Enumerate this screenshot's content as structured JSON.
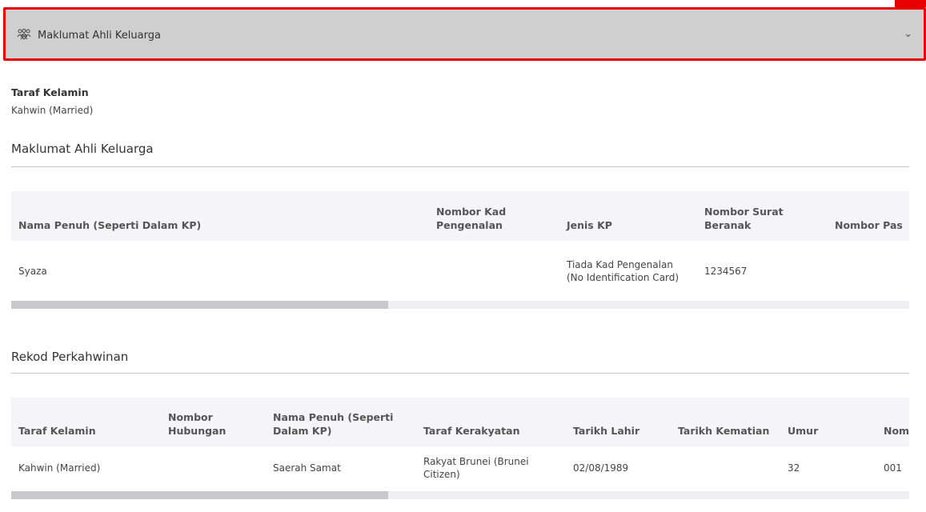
{
  "panel": {
    "title": "Maklumat Ahli Keluarga"
  },
  "marital": {
    "label": "Taraf Kelamin",
    "value": "Kahwin (Married)"
  },
  "family": {
    "title": "Maklumat Ahli Keluarga",
    "headers": [
      "Nama Penuh (Seperti Dalam KP)",
      "Nombor Kad Pengenalan",
      "Jenis KP",
      "Nombor Surat Beranak",
      "Nombor Pas"
    ],
    "rows": [
      [
        "Syaza",
        "",
        "Tiada Kad Pengenalan (No Identification Card)",
        "1234567",
        ""
      ]
    ],
    "scroll_fraction": 0.42
  },
  "marriage": {
    "title": "Rekod Perkahwinan",
    "headers": [
      "Taraf Kelamin",
      "Nombor Hubungan",
      "Nama Penuh (Seperti Dalam KP)",
      "Taraf Kerakyatan",
      "Tarikh Lahir",
      "Tarikh Kematian",
      "Umur",
      "Nombor Pengenalan"
    ],
    "rows": [
      [
        "Kahwin (Married)",
        "",
        "Saerah Samat",
        "Rakyat Brunei (Brunei Citizen)",
        "02/08/1989",
        "",
        "32",
        "001"
      ]
    ],
    "scroll_fraction": 0.42
  }
}
